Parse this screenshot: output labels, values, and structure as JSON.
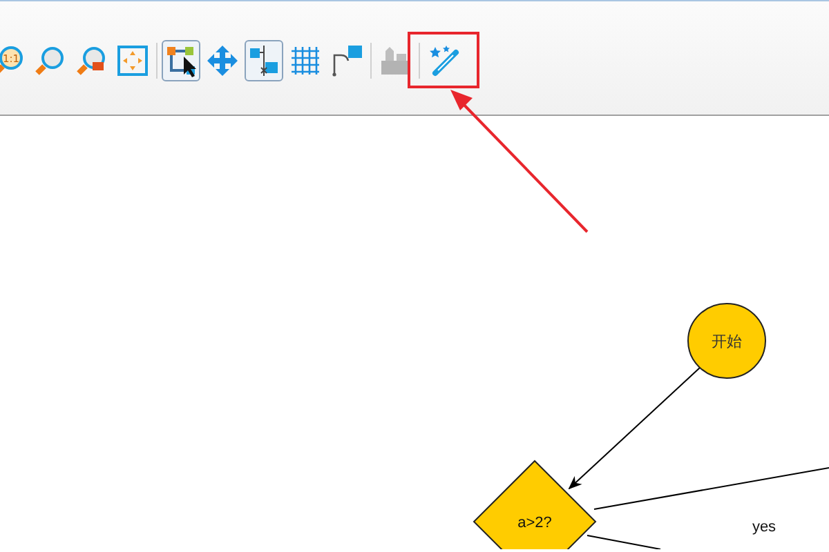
{
  "toolbar": {
    "items": [
      {
        "kind": "tool",
        "selected": false,
        "disabled": false,
        "label": "1:1"
      },
      {
        "kind": "tool",
        "selected": false,
        "disabled": false
      },
      {
        "kind": "tool",
        "selected": false,
        "disabled": false
      },
      {
        "kind": "tool",
        "selected": false,
        "disabled": false
      },
      {
        "kind": "separator"
      },
      {
        "kind": "tool",
        "selected": true,
        "disabled": false
      },
      {
        "kind": "tool",
        "selected": false,
        "disabled": false
      },
      {
        "kind": "tool",
        "selected": true,
        "disabled": false
      },
      {
        "kind": "tool",
        "selected": false,
        "disabled": false
      },
      {
        "kind": "tool",
        "selected": false,
        "disabled": false
      },
      {
        "kind": "separator"
      },
      {
        "kind": "tool",
        "selected": false,
        "disabled": true
      },
      {
        "kind": "separator"
      },
      {
        "kind": "tool",
        "selected": false,
        "disabled": false,
        "highlighted": true
      }
    ]
  },
  "canvas": {
    "nodes": [
      {
        "kind": "ellipse",
        "text": "开始"
      },
      {
        "kind": "diamond",
        "text": "a>2?"
      }
    ],
    "edge_labels": [
      "yes"
    ]
  }
}
